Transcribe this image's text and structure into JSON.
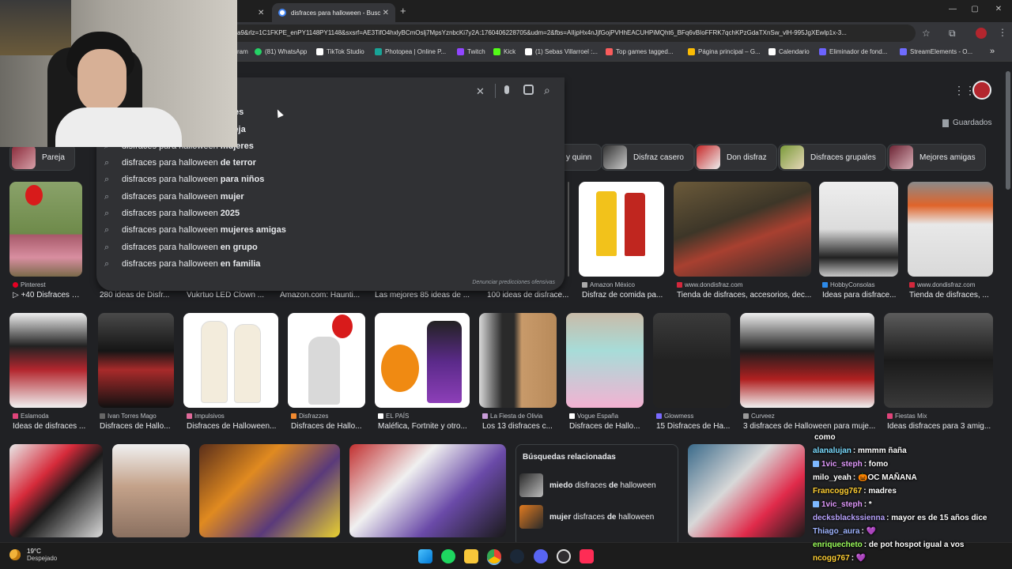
{
  "browser": {
    "tabs": [
      {
        "label": "",
        "active": false
      },
      {
        "label": "disfraces para halloween - Busc",
        "active": true
      }
    ],
    "new_tab": "+",
    "url": "a9&rlz=1C1FKPE_enPY1148PY1148&sxsrf=AE3TifO4hxlyBCmOslj7MpsYznbcKi7y2A:1760406228705&udm=2&fbs=AIIjpHx4nJjfGojPVHhEACUHPiMQht6_BFq6vBIoFFRK7qchKPzGdaTXnSw_vlH-995JgXEwlp1x-3...",
    "window": {
      "minimize": "—",
      "restore": "▢",
      "close": "✕"
    }
  },
  "bookmarks": [
    {
      "label": "ram",
      "color": "#e1306c"
    },
    {
      "label": "(81) WhatsApp",
      "color": "#25d366"
    },
    {
      "label": "TikTok Studio",
      "color": "#ffffff"
    },
    {
      "label": "Photopea | Online P...",
      "color": "#18a497"
    },
    {
      "label": "Twitch",
      "color": "#9146ff"
    },
    {
      "label": "Kick",
      "color": "#53fc18"
    },
    {
      "label": "(1) Sebas Villarroel :...",
      "color": "#ffffff"
    },
    {
      "label": "Top games tagged...",
      "color": "#fa5c5c"
    },
    {
      "label": "Página principal – G...",
      "color": "#fbbc04"
    },
    {
      "label": "Calendario",
      "color": "#ffffff"
    },
    {
      "label": "Eliminador de fond...",
      "color": "#6c63ff"
    },
    {
      "label": "StreamElements - O...",
      "color": "#6f6cff"
    }
  ],
  "bookmarks_more": "»",
  "search": {
    "clear": "✕",
    "suggestions": [
      {
        "prefix": "",
        "bold": "bres"
      },
      {
        "prefix": "",
        "bold": "areja"
      },
      {
        "prefix": "disfraces para halloween",
        "bold": "mujeres"
      },
      {
        "prefix": "disfraces para halloween",
        "bold": "de terror"
      },
      {
        "prefix": "disfraces para halloween",
        "bold": "para niños"
      },
      {
        "prefix": "disfraces para halloween",
        "bold": "mujer"
      },
      {
        "prefix": "disfraces para halloween",
        "bold": "2025"
      },
      {
        "prefix": "disfraces para halloween",
        "bold": "mujeres amigas"
      },
      {
        "prefix": "disfraces para halloween",
        "bold": "en grupo"
      },
      {
        "prefix": "disfraces para halloween",
        "bold": "en familia"
      }
    ],
    "report": "Denunciar predicciones ofensivas"
  },
  "saved_label": "Guardados",
  "chips": [
    {
      "label": "Pareja"
    },
    {
      "label": "y quinn"
    },
    {
      "label": "Disfraz casero"
    },
    {
      "label": "Don disfraz"
    },
    {
      "label": "Disfraces grupales"
    },
    {
      "label": "Mejores amigas"
    }
  ],
  "row1": [
    {
      "source": "Pinterest",
      "caption": "▷ +40 Disfraces C..."
    },
    {
      "source": "",
      "caption": "280 ideas de Disfr..."
    },
    {
      "source": "",
      "caption": "Vukrtuo LED Clown ..."
    },
    {
      "source": "",
      "caption": "Amazon.com: Haunti..."
    },
    {
      "source": "",
      "caption": "Las mejores 85 ideas de ..."
    },
    {
      "source": "",
      "caption": "100 ideas de disfrace..."
    },
    {
      "source": "Amazon México",
      "caption": "Disfraz de comida pa..."
    },
    {
      "source": "www.dondisfraz.com",
      "caption": "Tienda de disfraces, accesorios, dec..."
    },
    {
      "source": "HobbyConsolas",
      "caption": "Ideas para disfrace..."
    },
    {
      "source": "www.dondisfraz.com",
      "caption": "Tienda de disfraces, ..."
    }
  ],
  "row2": [
    {
      "source": "Eslamoda",
      "caption": "Ideas de disfraces ..."
    },
    {
      "source": "Ivan Torres Mago",
      "caption": "Disfraces de Hallo..."
    },
    {
      "source": "Impulsivos",
      "caption": "Disfraces de Halloween..."
    },
    {
      "source": "Disfrazzes",
      "caption": "Disfraces de Hallo..."
    },
    {
      "source": "EL PAÍS",
      "caption": "Maléfica, Fortnite y otro..."
    },
    {
      "source": "La Fiesta de Olivia",
      "caption": "Los 13 disfraces c..."
    },
    {
      "source": "Vogue España",
      "caption": "Disfraces de Hallo..."
    },
    {
      "source": "Glowmess",
      "caption": "15 Disfraces de Ha..."
    },
    {
      "source": "Curveez",
      "caption": "3 disfraces de Halloween para muje..."
    },
    {
      "source": "Fiestas Mix",
      "caption": "Ideas disfraces para 3 amig..."
    }
  ],
  "related": {
    "title": "Búsquedas relacionadas",
    "items": [
      {
        "pre": "miedo",
        "mid": " disfraces ",
        "b": "de",
        "post": " halloween"
      },
      {
        "pre": "mujer",
        "mid": " disfraces ",
        "b": "de",
        "post": " halloween"
      }
    ]
  },
  "weather": {
    "temp": "19°C",
    "desc": "Despejado"
  },
  "chat": [
    {
      "user": "",
      "text": "como",
      "color": "#ffffff",
      "badge": false
    },
    {
      "user": "alanalujan",
      "text": ": mmmm ñaña",
      "color": "#7bdcff",
      "badge": false
    },
    {
      "user": "1vic_steph",
      "text": ": fomo",
      "color": "#e39bff",
      "badge": true
    },
    {
      "user": "milo_yeah",
      "text": ": 🎃OC MAÑANA",
      "color": "#ffffff",
      "badge": false
    },
    {
      "user": "Francogg767",
      "text": ": madres",
      "color": "#ffcf33",
      "badge": false
    },
    {
      "user": "1vic_steph",
      "text": ": *",
      "color": "#e39bff",
      "badge": true
    },
    {
      "user": "decksblackssienna",
      "text": ": mayor es de 15 años dice",
      "color": "#b9a4ff",
      "badge": false
    },
    {
      "user": "Thiago_aura",
      "text": ": 💜",
      "color": "#9fb4ff",
      "badge": false
    },
    {
      "user": "enriquecheto",
      "text": ": de pot hospot igual a vos",
      "color": "#9dff5c",
      "badge": false
    },
    {
      "user": "ncogg767",
      "text": ": 💜",
      "color": "#ffcf33",
      "badge": false
    }
  ]
}
